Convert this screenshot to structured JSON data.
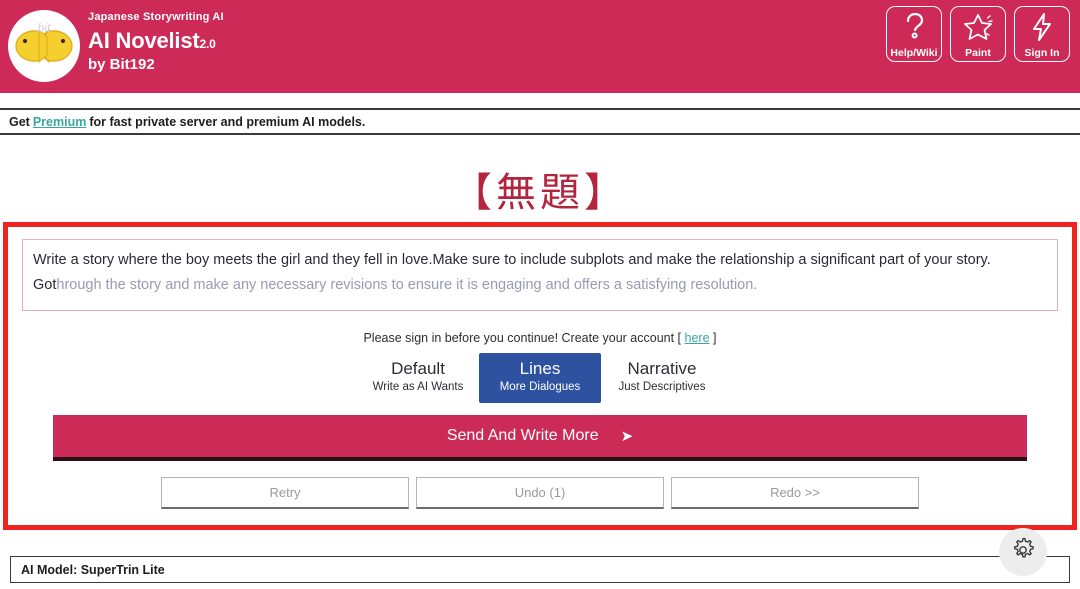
{
  "header": {
    "brand_tagline": "Japanese Storywriting AI",
    "brand_name": "AI Novelist",
    "brand_version": "2.0",
    "brand_author": "by Bit192",
    "logo_text": "bit",
    "actions": [
      {
        "label": "Help/Wiki",
        "icon": "question-mark-icon"
      },
      {
        "label": "Paint",
        "icon": "star-icon"
      },
      {
        "label": "Sign In",
        "icon": "lightning-bolt-icon"
      }
    ],
    "brand_color": "#ce2a57"
  },
  "premium_bar": {
    "prefix": "Get",
    "link": "Premium",
    "suffix": "for fast private server and premium AI models.",
    "link_color": "#3aa6a0"
  },
  "document": {
    "title": "【無題】",
    "title_color": "#b5243f"
  },
  "editor": {
    "typed_text": "Write a story where the boy meets the girl and they fell in love.Make sure to include subplots and make the relationship a significant part of your story. Got",
    "ghost_text": "hrough the story and make any necessary revisions to ensure it is engaging and offers a satisfying resolution.",
    "frame_color": "#ee2420"
  },
  "signin_note": {
    "text": "Please sign in before you continue! Create your account [",
    "link": "here",
    "close": "]"
  },
  "modes": [
    {
      "title": "Default",
      "subtitle": "Write as AI Wants",
      "selected": false
    },
    {
      "title": "Lines",
      "subtitle": "More Dialogues",
      "selected": true
    },
    {
      "title": "Narrative",
      "subtitle": "Just Descriptives",
      "selected": false
    }
  ],
  "modes_selected_color": "#2e52a0",
  "send_button": {
    "label": "Send And Write More",
    "arrow": "➤",
    "color": "#cc2a57"
  },
  "secondary_buttons": [
    {
      "label": "Retry",
      "name": "retry-button"
    },
    {
      "label": "Undo (1)",
      "name": "undo-button"
    },
    {
      "label": "Redo >>",
      "name": "redo-button"
    }
  ],
  "model_bar": {
    "label": "AI Model: SuperTrin Lite"
  },
  "settings": {
    "icon": "gear-icon"
  }
}
